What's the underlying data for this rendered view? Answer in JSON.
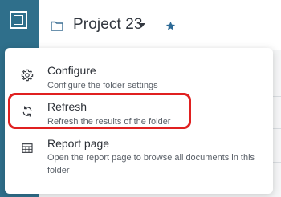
{
  "header": {
    "title": "Project 23",
    "folder_icon": "folder-icon",
    "caret_icon": "caret-down-icon",
    "star_icon": "star-icon",
    "accent_color": "#2f6f8b",
    "star_color": "#2d6a96"
  },
  "menu": {
    "items": [
      {
        "label": "Configure",
        "description": "Configure the folder settings",
        "icon": "gear-icon"
      },
      {
        "label": "Refresh",
        "description": "Refresh the results of the folder",
        "icon": "refresh-icon",
        "highlighted": true
      },
      {
        "label": "Report page",
        "description": "Open the report page to browse all documents in this folder",
        "icon": "table-icon"
      }
    ],
    "highlight_color": "#e02020"
  }
}
